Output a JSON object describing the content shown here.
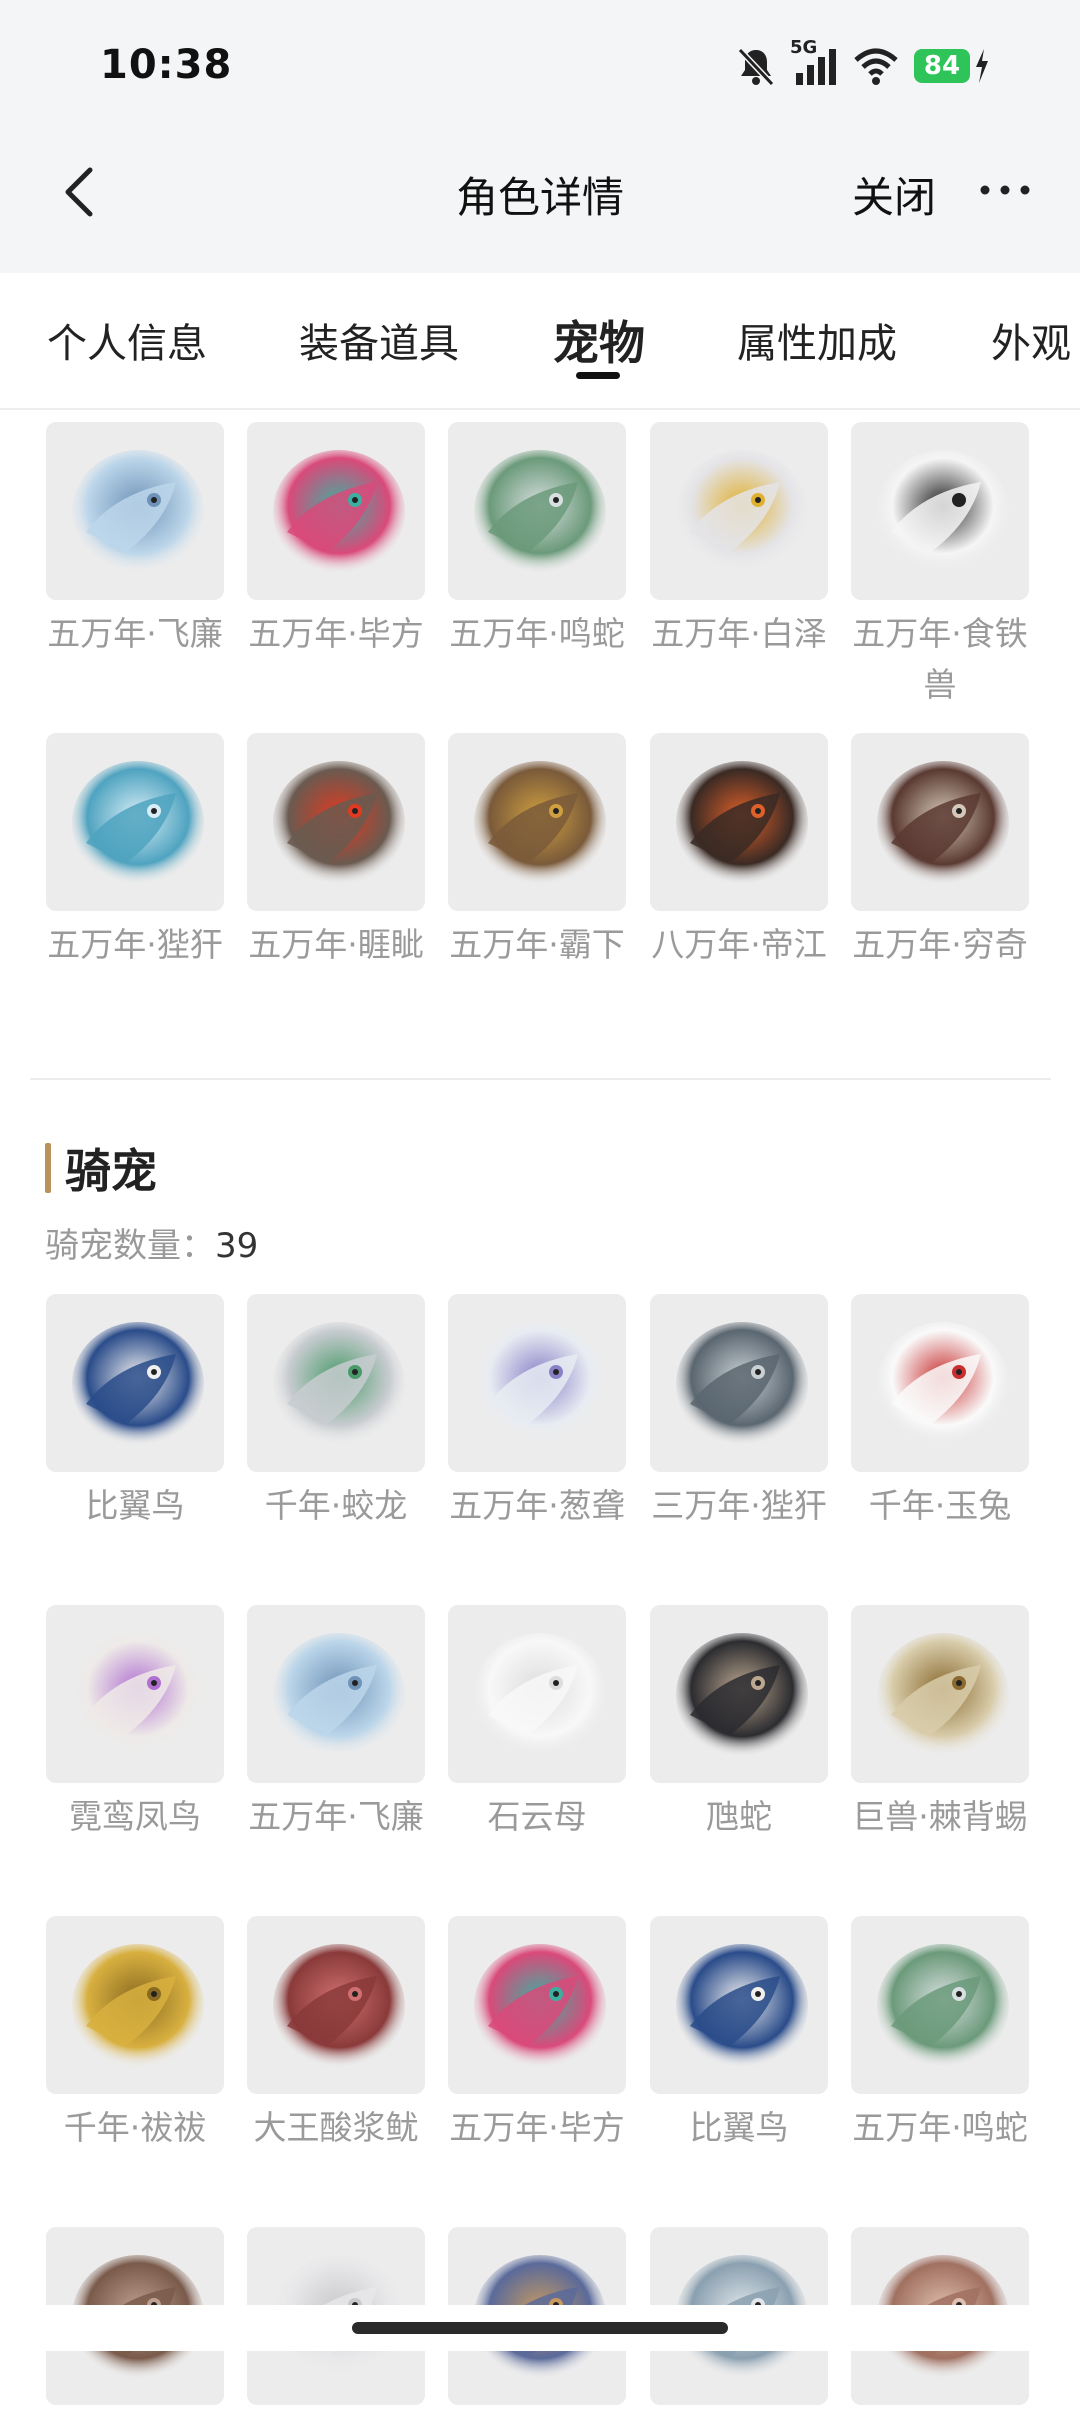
{
  "status": {
    "time": "10:38",
    "network": "5G",
    "battery": "84"
  },
  "nav": {
    "title": "角色详情",
    "close": "关闭"
  },
  "tabs": [
    "个人信息",
    "装备道具",
    "宠物",
    "属性加成",
    "外观"
  ],
  "pets": [
    {
      "label": "五万年·飞廉",
      "color": "#bcd6ea",
      "accent": "#6f93b8"
    },
    {
      "label": "五万年·毕方",
      "color": "#d94a7a",
      "accent": "#3bb0a0"
    },
    {
      "label": "五万年·鸣蛇",
      "color": "#6b9a7a",
      "accent": "#d8dfe0"
    },
    {
      "label": "五万年·白泽",
      "color": "#e4e4e8",
      "accent": "#e0b030"
    },
    {
      "label": "五万年·食铁兽",
      "color": "#f5f5f5",
      "accent": "#222222"
    },
    {
      "label": "五万年·狴犴",
      "color": "#4fa3c0",
      "accent": "#d8eef6"
    },
    {
      "label": "五万年·睚眦",
      "color": "#6a5a50",
      "accent": "#e03a20"
    },
    {
      "label": "五万年·霸下",
      "color": "#7a5a3a",
      "accent": "#d0a040"
    },
    {
      "label": "八万年·帝江",
      "color": "#3a2a24",
      "accent": "#e0602a"
    },
    {
      "label": "五万年·穷奇",
      "color": "#5a3a32",
      "accent": "#d6c8b8"
    }
  ],
  "mounts_section": {
    "title": "骑宠",
    "count_label": "骑宠数量：",
    "count": "39"
  },
  "mounts": [
    {
      "label": "比翼鸟",
      "color": "#2a4c8a",
      "accent": "#f0f0f0"
    },
    {
      "label": "千年·蛟龙",
      "color": "#c8ccd0",
      "accent": "#4a9a6a"
    },
    {
      "label": "五万年·葱聋",
      "color": "#e8ecf2",
      "accent": "#8a80c8"
    },
    {
      "label": "三万年·狴犴",
      "color": "#5a6670",
      "accent": "#c8d0d4"
    },
    {
      "label": "千年·玉兔",
      "color": "#fafafa",
      "accent": "#c83030"
    },
    {
      "label": "霓鸾凤鸟",
      "color": "#eeeae8",
      "accent": "#b070d0"
    },
    {
      "label": "五万年·飞廉",
      "color": "#bcd6ea",
      "accent": "#6f93b8"
    },
    {
      "label": "石云母",
      "color": "#f8f8f8",
      "accent": "#dddddd"
    },
    {
      "label": "虺蛇",
      "color": "#2c2c30",
      "accent": "#bca890"
    },
    {
      "label": "巨兽·棘背蜴",
      "color": "#d8ccaa",
      "accent": "#8a6a30"
    },
    {
      "label": "千年·祓祓",
      "color": "#d8b040",
      "accent": "#8a6a20"
    },
    {
      "label": "大王酸浆鱿",
      "color": "#8a3a3a",
      "accent": "#d07070"
    },
    {
      "label": "五万年·毕方",
      "color": "#d94a7a",
      "accent": "#3bb0a0"
    },
    {
      "label": "比翼鸟",
      "color": "#2a4c8a",
      "accent": "#f0f0f0"
    },
    {
      "label": "五万年·鸣蛇",
      "color": "#6b9a7a",
      "accent": "#d8dfe0"
    },
    {
      "label": "",
      "color": "#7a5a4a",
      "accent": "#c0a090"
    },
    {
      "label": "",
      "color": "#e8e8ea",
      "accent": "#c8c8cc"
    },
    {
      "label": "",
      "color": "#5a6a9a",
      "accent": "#c89a60"
    },
    {
      "label": "",
      "color": "#8aa0b0",
      "accent": "#e0e6ea"
    },
    {
      "label": "",
      "color": "#a07060",
      "accent": "#e0c0b0"
    }
  ]
}
